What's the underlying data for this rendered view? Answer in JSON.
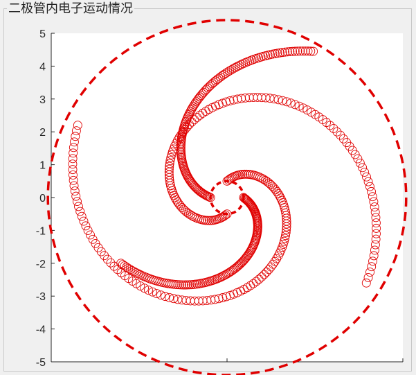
{
  "panel": {
    "title": "二极管内电子运动情况"
  },
  "chart_data": {
    "type": "scatter",
    "title": "",
    "xlabel": "",
    "ylabel": "",
    "xlim": [
      -5.3,
      5.3
    ],
    "ylim": [
      -5,
      5
    ],
    "yticks": [
      "5",
      "4",
      "3",
      "2",
      "1",
      "0",
      "-1",
      "-2",
      "-3",
      "-4",
      "-5"
    ],
    "grid": false,
    "colors": {
      "electron": "#e00000",
      "boundary": "#e00000",
      "axis": "#262626",
      "plot_bg": "#ffffff"
    },
    "circles": [
      {
        "name": "cathode",
        "radius": 0.5,
        "style": "dashed"
      },
      {
        "name": "anode",
        "radius": 5.4,
        "style": "dashed"
      }
    ],
    "series": [
      {
        "start": [
          0.5,
          0.0
        ],
        "end": [
          -3.2,
          -2.0
        ],
        "marker": "circle",
        "points_count": 130
      },
      {
        "start": [
          0.0,
          -0.5
        ],
        "end": [
          4.2,
          -2.6
        ],
        "marker": "circle",
        "points_count": 130
      },
      {
        "start": [
          -0.5,
          0.0
        ],
        "end": [
          2.6,
          4.45
        ],
        "marker": "circle",
        "points_count": 130
      },
      {
        "start": [
          0.0,
          0.5
        ],
        "end": [
          -4.5,
          2.2
        ],
        "marker": "circle",
        "points_count": 130
      }
    ]
  }
}
